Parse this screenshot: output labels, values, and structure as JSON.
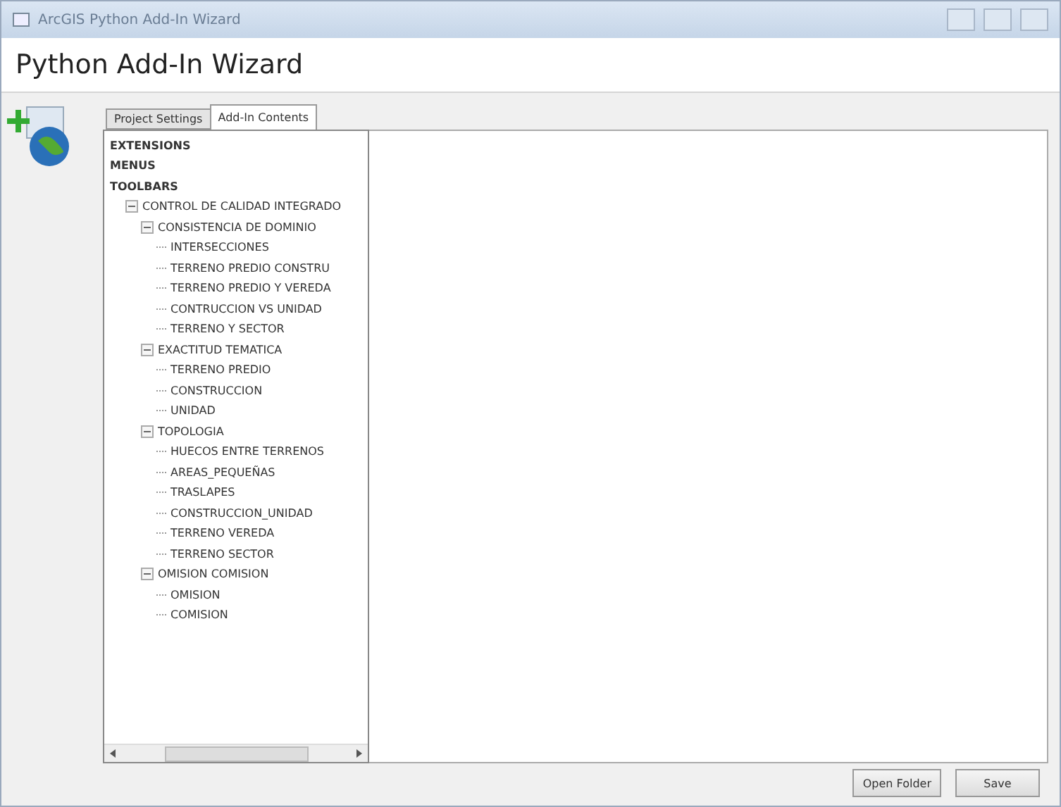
{
  "window": {
    "title": "ArcGIS Python Add-In Wizard"
  },
  "header": {
    "title": "Python Add-In Wizard"
  },
  "tabs": [
    {
      "label": "Project Settings",
      "selected": false
    },
    {
      "label": "Add-In Contents",
      "selected": true
    }
  ],
  "tree": [
    {
      "label": "EXTENSIONS",
      "bold": true
    },
    {
      "label": "MENUS",
      "bold": true
    },
    {
      "label": "TOOLBARS",
      "bold": true,
      "children": [
        {
          "label": "CONTROL DE CALIDAD INTEGRADO",
          "expanded": true,
          "children": [
            {
              "label": "CONSISTENCIA DE DOMINIO",
              "expanded": true,
              "children": [
                {
                  "label": "INTERSECCIONES"
                },
                {
                  "label": "TERRENO PREDIO CONSTRU"
                },
                {
                  "label": "TERRENO PREDIO Y VEREDA"
                },
                {
                  "label": "CONTRUCCION VS UNIDAD"
                },
                {
                  "label": "TERRENO Y SECTOR"
                }
              ]
            },
            {
              "label": "EXACTITUD TEMATICA",
              "expanded": true,
              "children": [
                {
                  "label": "TERRENO PREDIO"
                },
                {
                  "label": "CONSTRUCCION"
                },
                {
                  "label": "UNIDAD"
                }
              ]
            },
            {
              "label": "TOPOLOGIA",
              "expanded": true,
              "children": [
                {
                  "label": "HUECOS ENTRE TERRENOS"
                },
                {
                  "label": "AREAS_PEQUEÑAS"
                },
                {
                  "label": "TRASLAPES"
                },
                {
                  "label": "CONSTRUCCION_UNIDAD"
                },
                {
                  "label": "TERRENO VEREDA"
                },
                {
                  "label": "TERRENO SECTOR"
                }
              ]
            },
            {
              "label": "OMISION COMISION",
              "expanded": true,
              "children": [
                {
                  "label": "OMISION"
                },
                {
                  "label": "COMISION"
                }
              ]
            }
          ]
        }
      ]
    }
  ],
  "buttons": [
    "Open Folder",
    "Save"
  ]
}
